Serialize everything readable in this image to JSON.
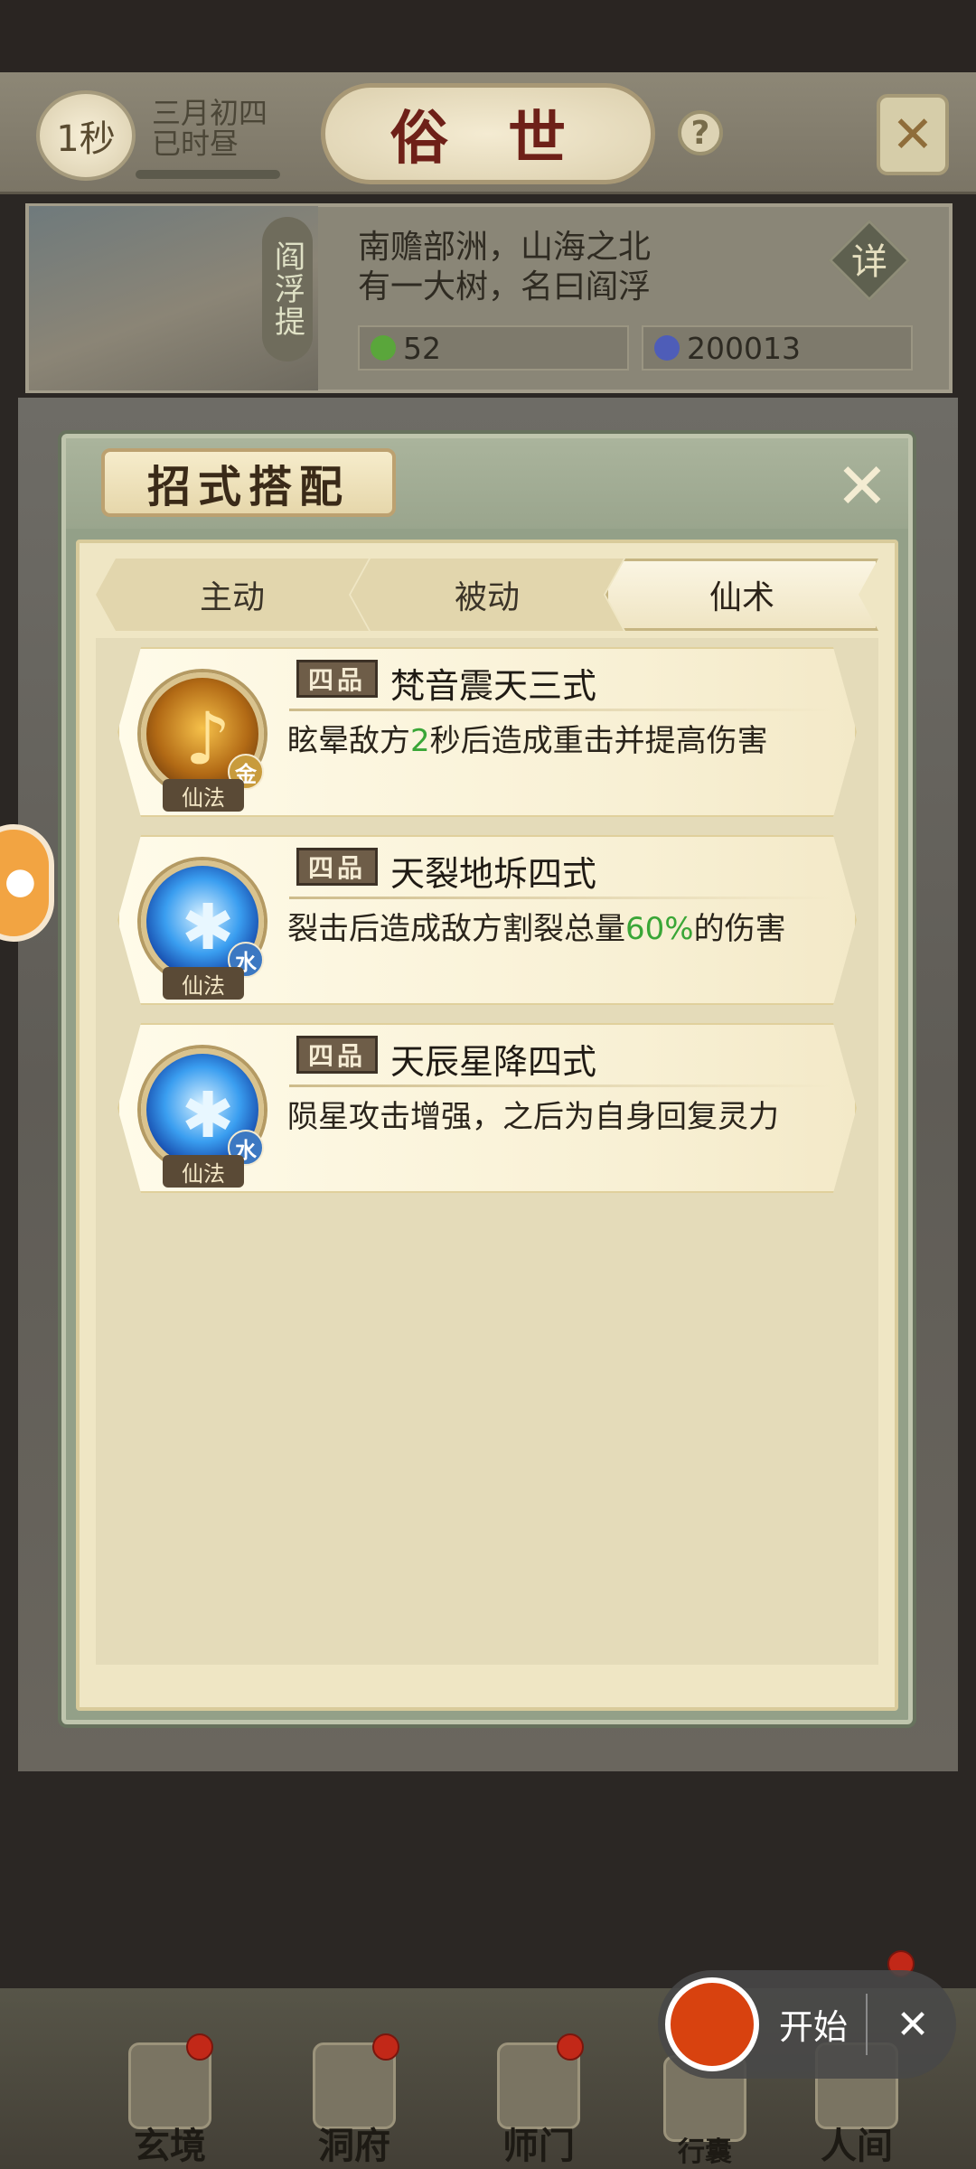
{
  "header": {
    "timer_label": "1秒",
    "date_line1": "三月初四",
    "date_line2": "已时昼",
    "title": "俗 世",
    "help_label": "?",
    "corner_icon": "crossed-swords-icon"
  },
  "location": {
    "vertical_label": "阎浮提",
    "desc_line1": "南赡部洲，山海之北",
    "desc_line2": "有一大树，名曰阎浮",
    "detail_label": "详",
    "resource_spirit": "52",
    "resource_coin": "200013"
  },
  "dialog": {
    "title": "招式搭配",
    "tabs": [
      {
        "label": "主动",
        "active": false
      },
      {
        "label": "被动",
        "active": false
      },
      {
        "label": "仙术",
        "active": true
      }
    ],
    "skills": [
      {
        "grade": "四品",
        "name": "梵音震天三式",
        "desc_pre": "眩晕敌方",
        "desc_hl": "2",
        "desc_post": "秒后造成重击并提高伤害",
        "type_label": "仙法",
        "element": "金",
        "icon": "music-note-icon"
      },
      {
        "grade": "四品",
        "name": "天裂地坼四式",
        "desc_pre": "裂击后造成敌方割裂总量",
        "desc_hl": "60%",
        "desc_post": "的伤害",
        "type_label": "仙法",
        "element": "水",
        "icon": "ice-burst-icon"
      },
      {
        "grade": "四品",
        "name": "天辰星降四式",
        "desc_pre": "陨星攻击增强，之后为自身回复灵力",
        "desc_hl": "",
        "desc_post": "",
        "type_label": "仙法",
        "element": "水",
        "icon": "ice-burst-icon"
      }
    ]
  },
  "bottom_nav": {
    "items": [
      {
        "label": "玄境"
      },
      {
        "label": "洞府"
      },
      {
        "label": "师门"
      },
      {
        "label": "行囊"
      },
      {
        "label": "人间"
      }
    ]
  },
  "recorder": {
    "start_label": "开始",
    "close_label": "✕"
  },
  "colors": {
    "highlight_green": "#3aa637",
    "record_red": "#d8420f",
    "title_red": "#6e2018"
  }
}
